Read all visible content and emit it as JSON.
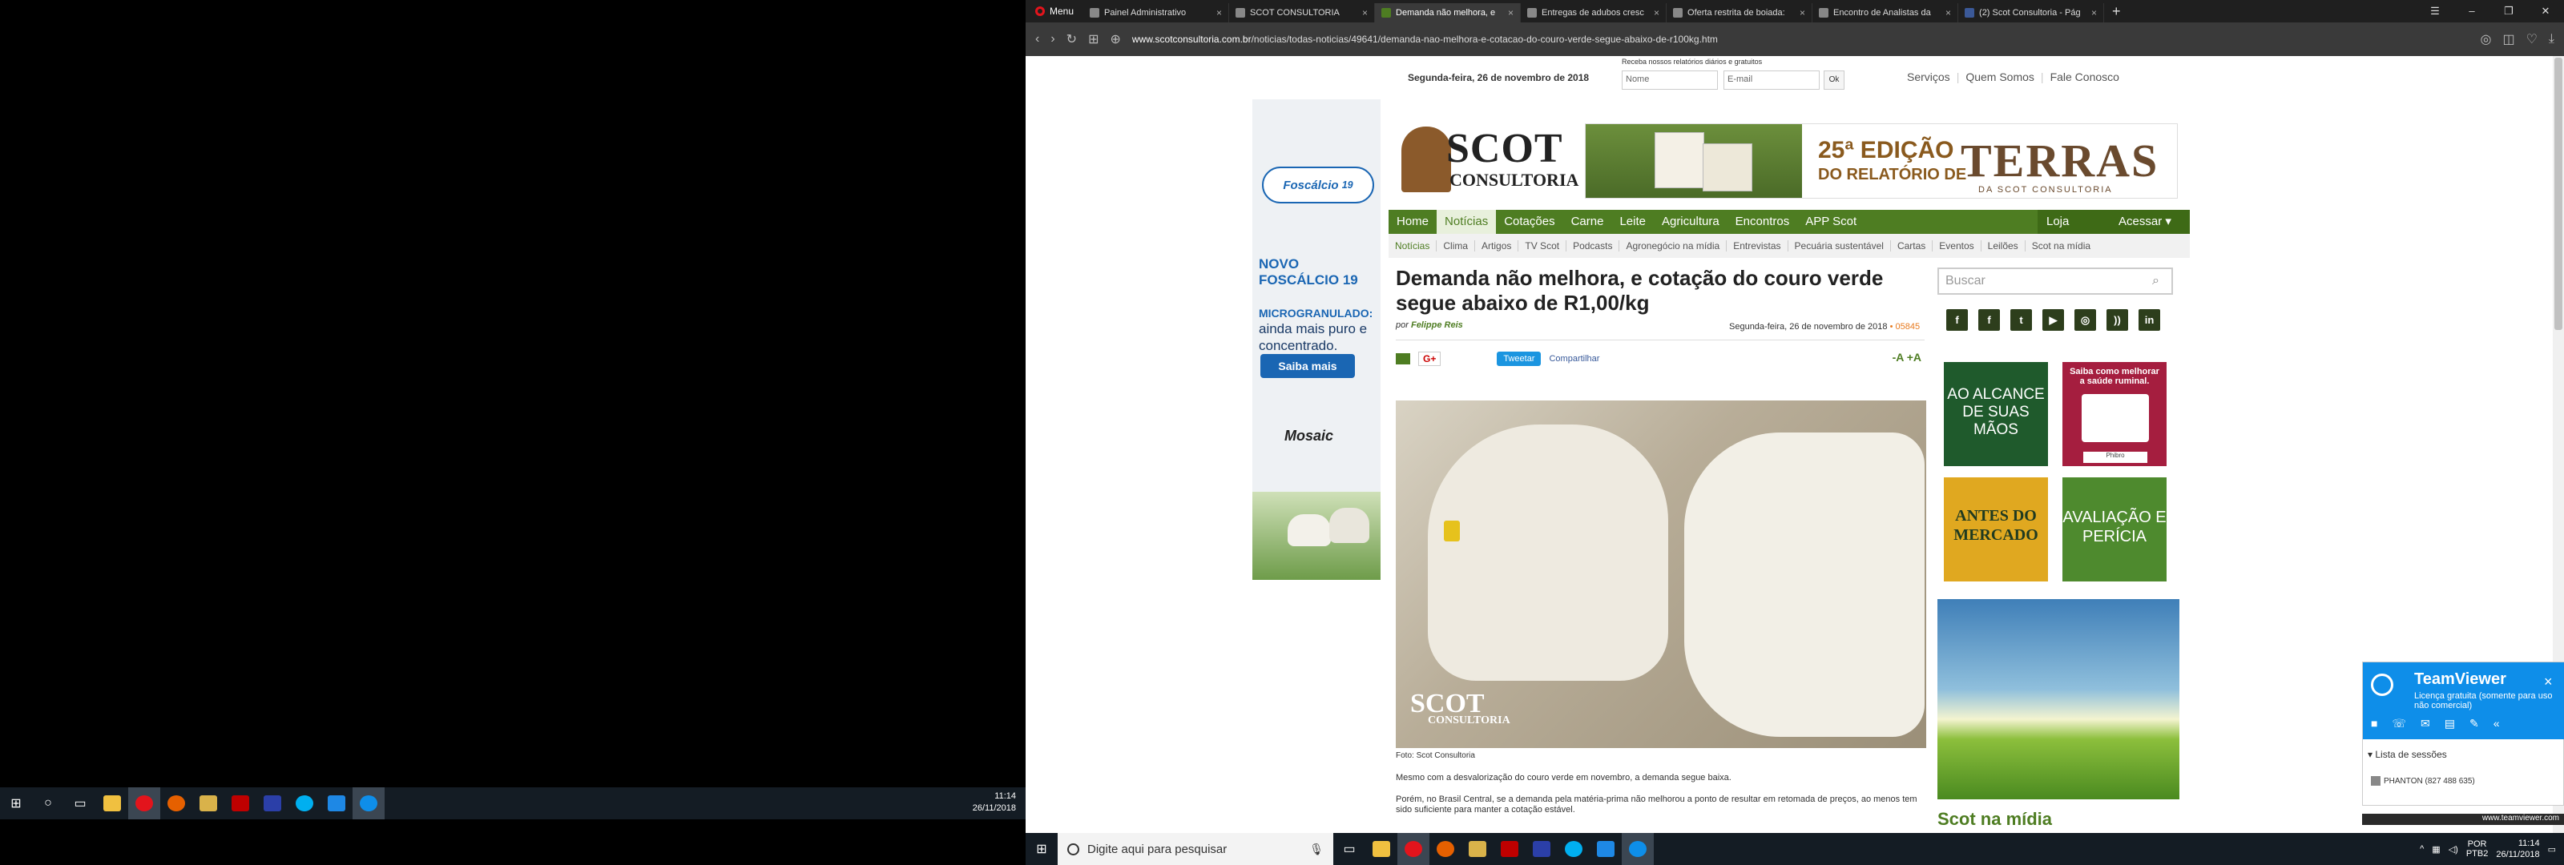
{
  "left_taskbar": {
    "time": "11:14",
    "date": "26/11/2018"
  },
  "browser": {
    "menu_label": "Menu",
    "tabs": [
      {
        "title": "Painel Administrativo",
        "active": false
      },
      {
        "title": "SCOT CONSULTORIA",
        "active": false
      },
      {
        "title": "Demanda não melhora, e",
        "active": true
      },
      {
        "title": "Entregas de adubos cresc",
        "active": false
      },
      {
        "title": "Oferta restrita de boiada:",
        "active": false
      },
      {
        "title": "Encontro de Analistas da",
        "active": false
      },
      {
        "title": "(2) Scot Consultoria - Pág",
        "active": false
      }
    ],
    "new_tab": "+",
    "url_domain": "www.scotconsultoria.com.br",
    "url_path": "/noticias/todas-noticias/49641/demanda-nao-melhora-e-cotacao-do-couro-verde-segue-abaixo-de-r100kg.htm"
  },
  "site": {
    "topbar": {
      "date": "Segunda-feira, 26 de novembro de 2018",
      "newsletter_label": "Receba nossos relatórios diários e gratuitos",
      "name_placeholder": "Nome",
      "email_placeholder": "E-mail",
      "ok_label": "Ok",
      "links": [
        "Serviços",
        "Quem Somos",
        "Fale Conosco"
      ],
      "sep": "|"
    },
    "left_ad": {
      "brand": "Foscálcio",
      "brand_num": "19",
      "headline": "NOVO FOSCÁLCIO 19",
      "sub": "MICROGRANULADO:",
      "sub2": "ainda mais puro e concentrado.",
      "button": "Saiba mais",
      "maker": "Mosaic"
    },
    "logo": {
      "scot": "SCOT",
      "consultoria": "CONSULTORIA"
    },
    "banner": {
      "edicao": "25ª EDIÇÃO",
      "relatorio": "DO RELATÓRIO DE",
      "terras": "TERRAS",
      "da_scot": "DA SCOT CONSULTORIA"
    },
    "main_nav": [
      "Home",
      "Notícias",
      "Cotações",
      "Carne",
      "Leite",
      "Agricultura",
      "Encontros",
      "APP Scot"
    ],
    "nav_right": [
      "Loja",
      "Acessar ▾"
    ],
    "sub_nav": [
      "Notícias",
      "Clima",
      "Artigos",
      "TV Scot",
      "Podcasts",
      "Agronegócio na mídia",
      "Entrevistas",
      "Pecuária sustentável",
      "Cartas",
      "Eventos",
      "Leilões",
      "Scot na mídia"
    ],
    "article": {
      "title": "Demanda não melhora, e cotação do couro verde segue abaixo de R1,00/kg",
      "author_prefix": "por",
      "author": "Felippe Reis",
      "date": "Segunda-feira, 26 de novembro de 2018",
      "views": "• 05845",
      "gplus": "G+",
      "tweet": "Tweetar",
      "share": "Compartilhar",
      "font_ctl": "-A +A",
      "photo_logo": "SCOT",
      "photo_logo2": "CONSULTORIA",
      "caption": "Foto: Scot Consultoria",
      "para1": "Mesmo com a desvalorização do couro verde em novembro, a demanda segue baixa.",
      "para2": "Porém, no Brasil Central, se a demanda pela matéria-prima não melhorou a ponto de resultar em retomada de preços, ao menos tem sido suficiente para manter a cotação estável."
    },
    "sidebar": {
      "search_placeholder": "Buscar",
      "social_icons": [
        "facebook-icon",
        "facebook-page-icon",
        "twitter-icon",
        "youtube-icon",
        "instagram-icon",
        "rss-icon",
        "linkedin-icon"
      ],
      "sq1": "AO ALCANCE DE SUAS MÃOS",
      "sq2": "Saiba como melhorar a saúde ruminal.",
      "sq2_brand": "Phibro",
      "sq3": "ANTES DO MERCADO",
      "sq4": "AVALIAÇÃO E PERÍCIA",
      "scot_na_midia": "Scot na mídia"
    }
  },
  "teamviewer": {
    "title": "TeamViewer",
    "subtitle": "Licença gratuita (somente para uso não comercial)",
    "list_label": "Lista de sessões",
    "session": "PHANTON (827 488 635)",
    "link": "www.teamviewer.com",
    "close": "×"
  },
  "right_taskbar": {
    "search_placeholder": "Digite aqui para pesquisar",
    "lang1": "POR",
    "lang2": "PTB2",
    "time": "11:14",
    "date": "26/11/2018"
  }
}
